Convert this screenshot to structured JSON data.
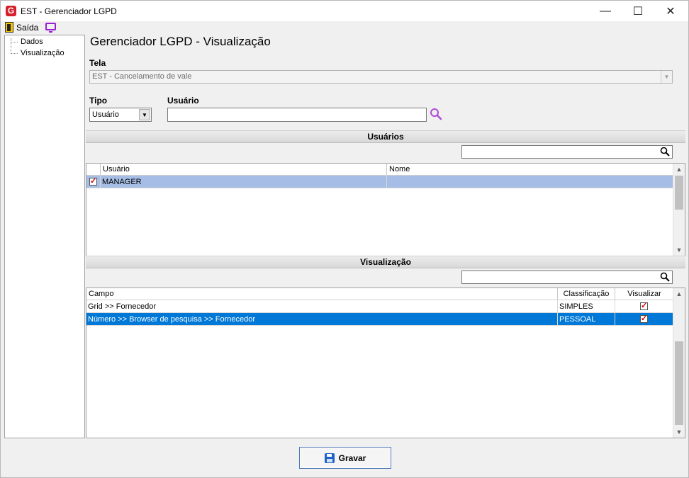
{
  "window": {
    "title": "EST - Gerenciador LGPD",
    "minimize": "—",
    "maximize": "☐",
    "close": "✕"
  },
  "menu": {
    "exit_label": "Saída"
  },
  "sidebar": {
    "items": [
      {
        "label": "Dados"
      },
      {
        "label": "Visualização"
      }
    ]
  },
  "page": {
    "title": "Gerenciador LGPD - Visualização"
  },
  "form": {
    "tela_label": "Tela",
    "tela_value": "EST - Cancelamento de vale",
    "tipo_label": "Tipo",
    "tipo_value": "Usuário",
    "usuario_label": "Usuário",
    "usuario_value": ""
  },
  "usuarios_section": {
    "header": "Usuários",
    "filter_value": "",
    "columns": [
      "Usuário",
      "Nome"
    ],
    "rows": [
      {
        "checked": true,
        "usuario": "MANAGER",
        "nome": ""
      }
    ]
  },
  "visualizacao_section": {
    "header": "Visualização",
    "filter_value": "",
    "columns": [
      "Campo",
      "Classificação",
      "Visualizar"
    ],
    "rows": [
      {
        "campo": "Grid >> Fornecedor",
        "classificacao": "SIMPLES",
        "visualizar": true
      },
      {
        "campo": "Número >> Browser de pesquisa >> Fornecedor",
        "classificacao": "PESSOAL",
        "visualizar": true
      }
    ]
  },
  "actions": {
    "save_label": "Gravar"
  },
  "colors": {
    "selected_row_light": "#a6bee6",
    "selected_row_dark": "#0078d7",
    "accent_purple": "#9b1fd1",
    "app_icon_red": "#d5202b"
  }
}
